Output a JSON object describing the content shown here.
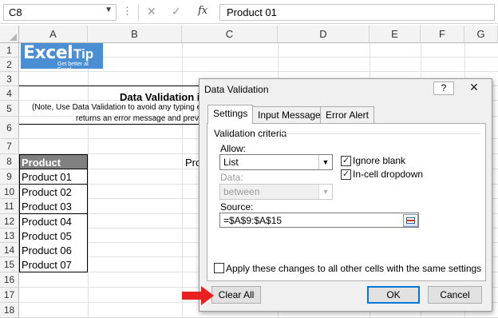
{
  "formula_bar": {
    "name_box": "C8",
    "cancel_icon": "✕",
    "enter_icon": "✓",
    "fx_label": "fx",
    "formula": "Product 01"
  },
  "columns": [
    "A",
    "B",
    "C",
    "D",
    "E",
    "F",
    "G"
  ],
  "rows": [
    "1",
    "2",
    "3",
    "4",
    "5",
    "6",
    "7",
    "8",
    "9",
    "10",
    "11",
    "12",
    "13",
    "14",
    "15",
    "16",
    "17",
    "18"
  ],
  "logo": {
    "main": "Excel",
    "tip": "Tip",
    "tagline": "Get better at Excel"
  },
  "sheet": {
    "title": "Data Validation in",
    "note_line1": "(Note, Use Data Validation to avoid any typing er",
    "note_line2": "returns an error message and preve",
    "c8_fragment": "Pro",
    "list_header": "Product Name",
    "list_items": [
      "Product 01",
      "Product 02",
      "Product 03",
      "Product 04",
      "Product 05",
      "Product 06",
      "Product 07"
    ]
  },
  "dialog": {
    "title": "Data Validation",
    "help_label": "?",
    "close_label": "✕",
    "tabs": [
      "Settings",
      "Input Message",
      "Error Alert"
    ],
    "group_label": "Validation criteria",
    "allow_label": "Allow:",
    "allow_value": "List",
    "data_label": "Data:",
    "data_value": "between",
    "ignore_blank_label": "Ignore blank",
    "ignore_blank_checked": true,
    "incell_dropdown_label": "In-cell dropdown",
    "incell_dropdown_checked": true,
    "source_label": "Source:",
    "source_value": "=$A$9:$A$15",
    "apply_label": "Apply these changes to all other cells with the same settings",
    "apply_checked": false,
    "clear_all_label": "Clear All",
    "ok_label": "OK",
    "cancel_label": "Cancel"
  },
  "accent_colors": {
    "logo_bg": "#4a8fd4",
    "header_bg": "#808080",
    "arrow": "#e8201f",
    "focus": "#0078d7"
  }
}
